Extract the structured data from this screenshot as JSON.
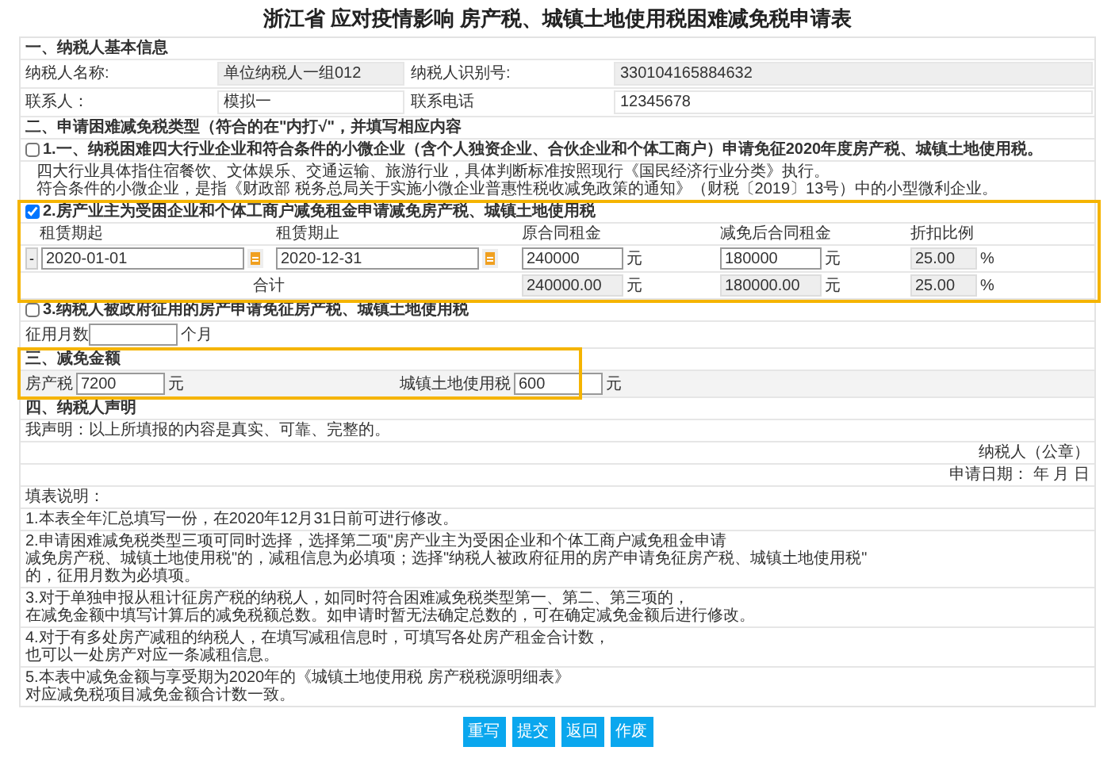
{
  "title": "浙江省 应对疫情影响 房产税、城镇土地使用税困难减免税申请表",
  "taxpayer_info": {
    "heading": "一、纳税人基本信息",
    "fields": [
      {
        "label": "纳税人名称:",
        "value": "单位纳税人一组012",
        "disabled": true
      },
      {
        "label": "纳税人识别号:",
        "value": "330104165884632",
        "disabled": true
      },
      {
        "label": "联系人：",
        "value": "模拟一",
        "disabled": false
      },
      {
        "label": "联系电话",
        "value": "12345678",
        "disabled": false
      }
    ]
  },
  "relief_types": {
    "heading": "二、申请困难减免税类型（符合的在\"内打√\"，并填写相应内容",
    "options": [
      {
        "kind": "notes",
        "checked": false,
        "label": "1.一、纳税困难四大行业企业和符合条件的小微企业（含个人独资企业、合伙企业和个体工商户）申请免征2020年度房产税、城镇土地使用税。",
        "notes": [
          "四大行业具体指住宿餐饮、文体娱乐、交通运输、旅游行业，具体判断标准按照现行《国民经济行业分类》执行。",
          "符合条件的小微企业，是指《财政部 税务总局关于实施小微企业普惠性税收减免政策的通知》（财税〔2019〕13号）中的小型微利企业。"
        ]
      },
      {
        "kind": "rent",
        "checked": true,
        "label": "2.房产业主为受困企业和个体工商户减免租金申请减免房产税、城镇土地使用税",
        "columns": [
          "租赁期起",
          "租赁期止",
          "原合同租金",
          "减免后合同租金",
          "折扣比例"
        ],
        "rows": [
          {
            "remove": "-",
            "start": "2020-01-01",
            "end": "2020-12-31",
            "amounts": [
              {
                "value": "240000",
                "unit": "元",
                "disabled": false
              },
              {
                "value": "180000",
                "unit": "元",
                "disabled": false
              },
              {
                "value": "25.00",
                "unit": "%",
                "disabled": true
              }
            ]
          }
        ],
        "total": {
          "label": "合计",
          "amounts": [
            {
              "value": "240000.00",
              "unit": "元",
              "disabled": true
            },
            {
              "value": "180000.00",
              "unit": "元",
              "disabled": true
            },
            {
              "value": "25.00",
              "unit": "%",
              "disabled": true
            }
          ]
        }
      },
      {
        "kind": "months",
        "checked": false,
        "label": "3.纳税人被政府征用的房产申请免征房产税、城镇土地使用税",
        "field_label": "征用月数",
        "unit": "个月"
      }
    ]
  },
  "relief_amount": {
    "heading": "三、减免金额",
    "fields": [
      {
        "label": "房产税",
        "value": "7200",
        "unit": "元"
      },
      {
        "label": "城镇土地使用税",
        "value": "600",
        "unit": "元"
      }
    ]
  },
  "declaration": {
    "heading": "四、纳税人声明",
    "statement": "我声明：以上所填报的内容是真实、可靠、完整的。",
    "seal": "纳税人（公章）",
    "date": "申请日期： 年 月 日"
  },
  "instructions": {
    "heading": "填表说明：",
    "items": [
      [
        "1.本表全年汇总填写一份，在2020年12月31日前可进行修改。"
      ],
      [
        "2.申请困难减免税类型三项可同时选择，选择第二项\"房产业主为受困企业和个体工商户减免租金申请",
        "减免房产税、城镇土地使用税\"的，减租信息为必填项；选择\"纳税人被政府征用的房产申请免征房产税、城镇土地使用税\"",
        "的，征用月数为必填项。"
      ],
      [
        "3.对于单独申报从租计征房产税的纳税人，如同时符合困难减免税类型第一、第二、第三项的，",
        "在减免金额中填写计算后的减免税额总数。如申请时暂无法确定总数的，可在确定减免金额后进行修改。"
      ],
      [
        "4.对于有多处房产减租的纳税人，在填写减租信息时，可填写各处房产租金合计数，",
        "也可以一处房产对应一条减租信息。"
      ],
      [
        "5.本表中减免金额与享受期为2020年的《城镇土地使用税 房产税税源明细表》",
        "对应减免税项目减免金额合计数一致。"
      ]
    ]
  },
  "buttons": [
    "重写",
    "提交",
    "返回",
    "作废"
  ]
}
